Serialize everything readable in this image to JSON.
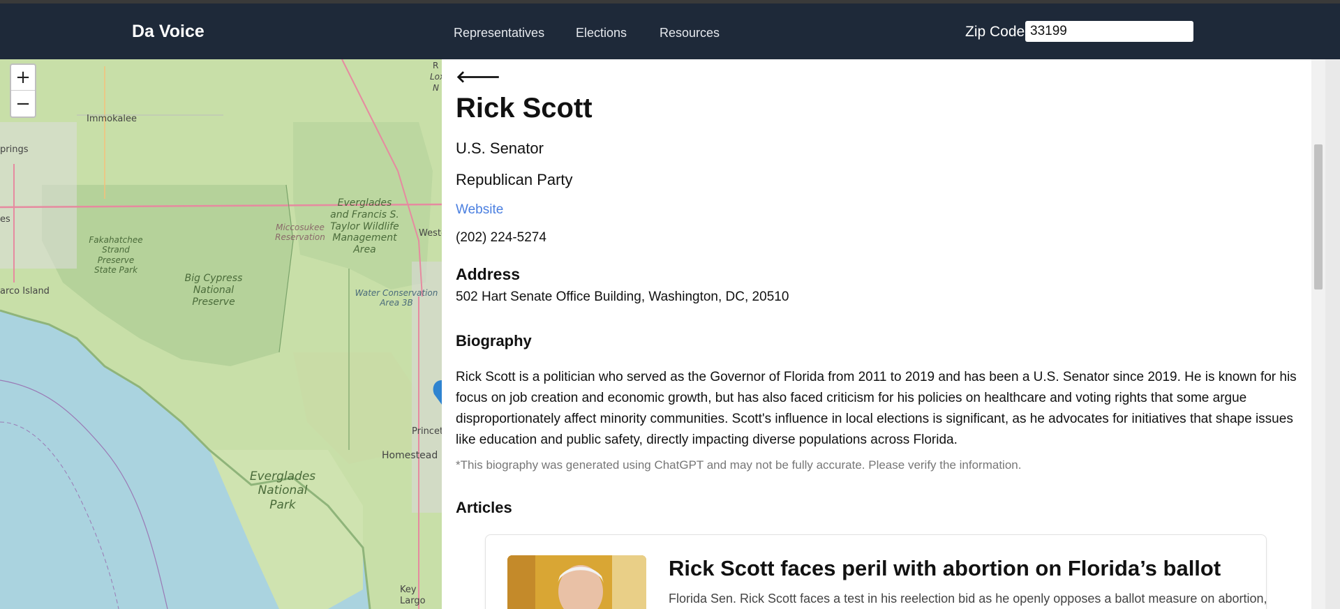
{
  "header": {
    "brand": "Da Voice",
    "nav": [
      "Representatives",
      "Elections",
      "Resources"
    ],
    "zip_label": "Zip Code",
    "zip_value": "33199"
  },
  "map": {
    "zoom_in": "+",
    "zoom_out": "−",
    "labels": {
      "immokalee": "Immokalee",
      "springs": "prings",
      "es": "es",
      "marco": "arco Island",
      "fakahatchee": "Fakahatchee Strand Preserve State Park",
      "big_cypress": "Big Cypress National Preserve",
      "miccosukee": "Miccosukee Reservation",
      "everglades_wma": "Everglades and Francis S. Taylor Wildlife Management Area",
      "weston": "Westo",
      "water_conservation": "Water Conservation Area 3B",
      "everglades_np": "Everglades National Park",
      "homestead": "Homestead",
      "princeton": "Princet",
      "key_largo": "Key Largo",
      "top_r": "R",
      "top_lox": "Lox",
      "top_n": "N"
    }
  },
  "rep": {
    "back": "🡐",
    "name": "Rick Scott",
    "office": "U.S. Senator",
    "party": "Republican Party",
    "website": "Website",
    "phone": "(202) 224-5274",
    "address_heading": "Address",
    "address": "502 Hart Senate Office Building, Washington, DC, 20510",
    "bio_heading": "Biography",
    "bio": "Rick Scott is a politician who served as the Governor of Florida from 2011 to 2019 and has been a U.S. Senator since 2019. He is known for his focus on job creation and economic growth, but has also faced criticism for his policies on healthcare and voting rights that some argue disproportionately affect minority communities. Scott's influence in local elections is significant, as he advocates for initiatives that shape issues like education and public safety, directly impacting diverse populations across Florida.",
    "bio_note": "*This biography was generated using ChatGPT and may not be fully accurate. Please verify the information.",
    "articles_heading": "Articles"
  },
  "articles": [
    {
      "title": "Rick Scott faces peril with abortion on Florida’s ballot",
      "snippet": "Florida Sen. Rick Scott faces a test in his reelection bid as he openly opposes a ballot measure on abortion,"
    }
  ],
  "colors": {
    "navbar": "#1e2939",
    "link": "#4a7fe0",
    "map_water": "#aad3df",
    "map_land": "#c8dfa8"
  }
}
